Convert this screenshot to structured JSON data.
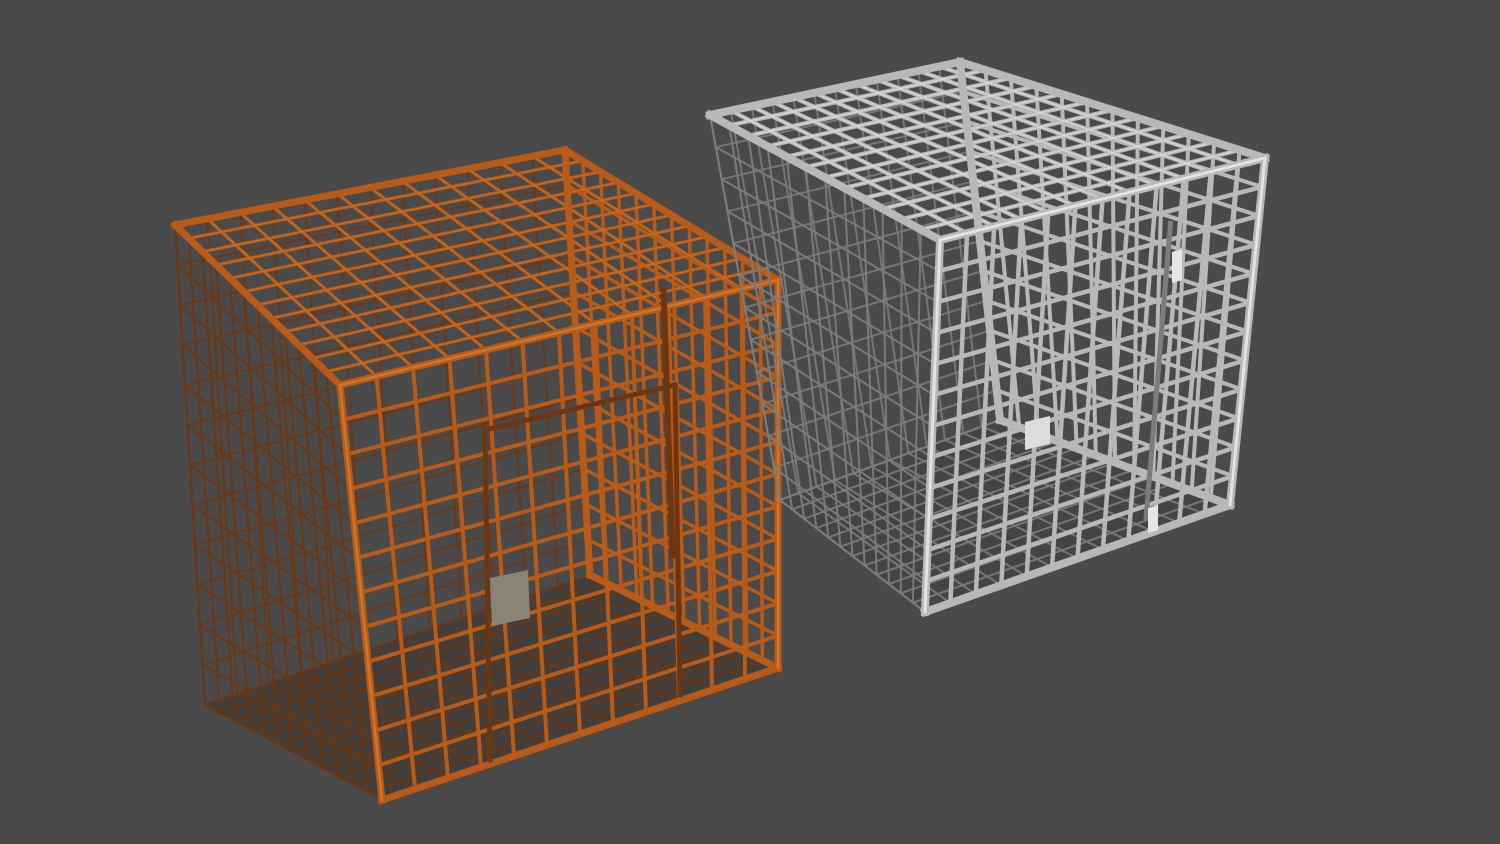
{
  "scene": {
    "background": "#4a4a4a",
    "objects": [
      {
        "name": "rusty-cage",
        "material": "rusted-steel",
        "colors": {
          "base": "#b85a18",
          "highlight": "#d0762a",
          "dark": "#6e3610",
          "shadow": "#2e2a26"
        },
        "grid_divisions": 12,
        "has_door": true,
        "has_lock_plate": true
      },
      {
        "name": "steel-cage",
        "material": "galvanized-steel",
        "colors": {
          "base": "#b8b8b8",
          "highlight": "#e4e4e4",
          "dark": "#7c7c7c",
          "shadow": "#3a3a3a"
        },
        "grid_divisions": 12,
        "has_door": true,
        "has_lock_plate": true
      }
    ]
  }
}
